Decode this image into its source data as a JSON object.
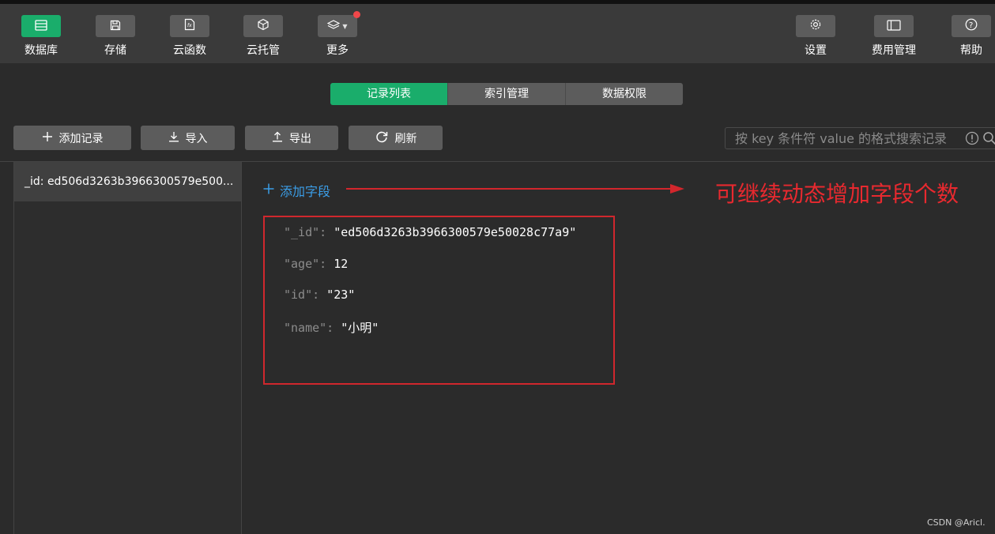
{
  "toolbar": {
    "left": [
      {
        "label": "数据库",
        "icon": "database-icon",
        "active": true
      },
      {
        "label": "存储",
        "icon": "save-icon"
      },
      {
        "label": "云函数",
        "icon": "function-icon"
      },
      {
        "label": "云托管",
        "icon": "cube-icon"
      },
      {
        "label": "更多",
        "icon": "layers-icon",
        "has_badge": true
      }
    ],
    "right": [
      {
        "label": "设置",
        "icon": "gear-icon"
      },
      {
        "label": "费用管理",
        "icon": "billing-icon"
      },
      {
        "label": "帮助",
        "icon": "help-icon"
      }
    ]
  },
  "tabs": [
    {
      "label": "记录列表",
      "active": true
    },
    {
      "label": "索引管理"
    },
    {
      "label": "数据权限"
    }
  ],
  "actions": {
    "add_record": "添加记录",
    "import": "导入",
    "export": "导出",
    "refresh": "刷新"
  },
  "search": {
    "placeholder": "按 key 条件符 value 的格式搜索记录"
  },
  "records": [
    {
      "label": "_id: ed506d3263b3966300579e500..."
    }
  ],
  "detail": {
    "add_field": "添加字段",
    "fields": [
      {
        "key": "\"_id\":",
        "value": "\"ed506d3263b3966300579e50028c77a9\""
      },
      {
        "key": "\"age\":",
        "value": "12"
      },
      {
        "key": "\"id\":",
        "value": "\"23\""
      },
      {
        "key": "\"name\":",
        "value": "\"小明\""
      }
    ]
  },
  "annotation": "可继续动态增加字段个数",
  "watermark": "CSDN @Aricl.",
  "colors": {
    "accent": "#1aad6b",
    "annotation_red": "#e8292f",
    "link_blue": "#3b9ee8",
    "badge_red": "#f0474a"
  }
}
